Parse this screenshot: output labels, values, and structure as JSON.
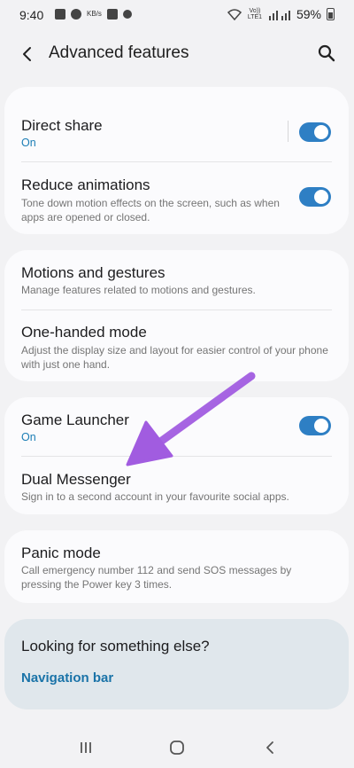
{
  "status_bar": {
    "time": "9:40",
    "kb_label": "KB/s",
    "lte_label": "Vo)) LTE1",
    "battery": "59%"
  },
  "app_bar": {
    "title": "Advanced features",
    "back_icon": "chevron-left-icon",
    "search_icon": "search-icon"
  },
  "cards": [
    {
      "rows": [
        {
          "title": "Direct share",
          "status": "On",
          "toggle": true
        },
        {
          "title": "Reduce animations",
          "subtitle": "Tone down motion effects on the screen, such as when apps are opened or closed.",
          "toggle": true
        }
      ]
    },
    {
      "rows": [
        {
          "title": "Motions and gestures",
          "subtitle": "Manage features related to motions and gestures."
        },
        {
          "title": "One-handed mode",
          "subtitle": "Adjust the display size and layout for easier control of your phone with just one hand."
        }
      ]
    },
    {
      "rows": [
        {
          "title": "Game Launcher",
          "status": "On",
          "toggle": true
        },
        {
          "title": "Dual Messenger",
          "subtitle": "Sign in to a second account in your favourite social apps."
        }
      ]
    },
    {
      "rows": [
        {
          "title": "Panic mode",
          "subtitle": "Call emergency number 112 and send SOS messages by pressing the Power key 3 times."
        }
      ]
    }
  ],
  "help": {
    "title": "Looking for something else?",
    "link": "Navigation bar"
  },
  "nav_bar": {
    "recents_icon": "recents-icon",
    "home_icon": "home-icon",
    "back_icon": "back-icon"
  },
  "colors": {
    "accent": "#2e7fc4",
    "link": "#1a73a8",
    "annotation_arrow": "#a15ce0"
  }
}
